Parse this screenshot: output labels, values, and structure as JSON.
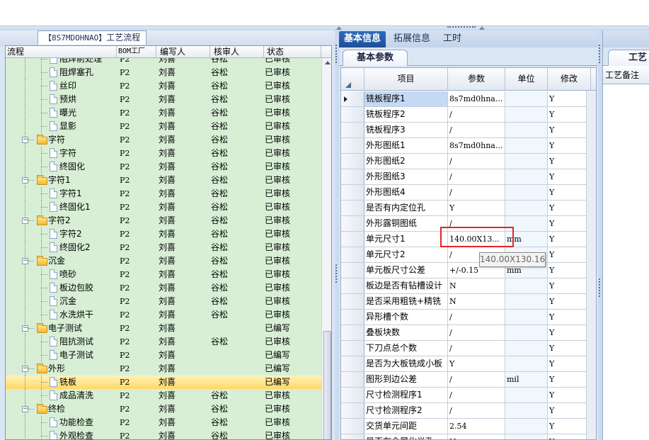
{
  "left_panel": {
    "tab_code": "【8S7MDOHNAO】",
    "tab_label": "工艺流程",
    "columns": [
      "流程",
      "BOM工厂",
      "编写人",
      "核审人",
      "状态"
    ],
    "rows": [
      {
        "level": 2,
        "type": "doc",
        "name": "阻焊前处理",
        "bom": "P2",
        "writer": "刘喜",
        "reviewer": "谷松",
        "status": "已审核"
      },
      {
        "level": 2,
        "type": "doc",
        "name": "阻焊塞孔",
        "bom": "P2",
        "writer": "刘喜",
        "reviewer": "谷松",
        "status": "已审核"
      },
      {
        "level": 2,
        "type": "doc",
        "name": "丝印",
        "bom": "P2",
        "writer": "刘喜",
        "reviewer": "谷松",
        "status": "已审核"
      },
      {
        "level": 2,
        "type": "doc",
        "name": "预烘",
        "bom": "P2",
        "writer": "刘喜",
        "reviewer": "谷松",
        "status": "已审核"
      },
      {
        "level": 2,
        "type": "doc",
        "name": "曝光",
        "bom": "P2",
        "writer": "刘喜",
        "reviewer": "谷松",
        "status": "已审核"
      },
      {
        "level": 2,
        "type": "doc",
        "name": "显影",
        "bom": "P2",
        "writer": "刘喜",
        "reviewer": "谷松",
        "status": "已审核"
      },
      {
        "level": 1,
        "type": "folder",
        "name": "字符",
        "bom": "P2",
        "writer": "刘喜",
        "reviewer": "谷松",
        "status": "已审核"
      },
      {
        "level": 2,
        "type": "doc",
        "name": "字符",
        "bom": "P2",
        "writer": "刘喜",
        "reviewer": "谷松",
        "status": "已审核"
      },
      {
        "level": 2,
        "type": "doc",
        "name": "终固化",
        "bom": "P2",
        "writer": "刘喜",
        "reviewer": "谷松",
        "status": "已审核"
      },
      {
        "level": 1,
        "type": "folder",
        "name": "字符1",
        "bom": "P2",
        "writer": "刘喜",
        "reviewer": "谷松",
        "status": "已审核"
      },
      {
        "level": 2,
        "type": "doc",
        "name": "字符1",
        "bom": "P2",
        "writer": "刘喜",
        "reviewer": "谷松",
        "status": "已审核"
      },
      {
        "level": 2,
        "type": "doc",
        "name": "终固化1",
        "bom": "P2",
        "writer": "刘喜",
        "reviewer": "谷松",
        "status": "已审核"
      },
      {
        "level": 1,
        "type": "folder",
        "name": "字符2",
        "bom": "P2",
        "writer": "刘喜",
        "reviewer": "谷松",
        "status": "已审核"
      },
      {
        "level": 2,
        "type": "doc",
        "name": "字符2",
        "bom": "P2",
        "writer": "刘喜",
        "reviewer": "谷松",
        "status": "已审核"
      },
      {
        "level": 2,
        "type": "doc",
        "name": "终固化2",
        "bom": "P2",
        "writer": "刘喜",
        "reviewer": "谷松",
        "status": "已审核"
      },
      {
        "level": 1,
        "type": "folder",
        "name": "沉金",
        "bom": "P2",
        "writer": "刘喜",
        "reviewer": "谷松",
        "status": "已审核"
      },
      {
        "level": 2,
        "type": "doc",
        "name": "喷砂",
        "bom": "P2",
        "writer": "刘喜",
        "reviewer": "谷松",
        "status": "已审核"
      },
      {
        "level": 2,
        "type": "doc",
        "name": "板边包胶",
        "bom": "P2",
        "writer": "刘喜",
        "reviewer": "谷松",
        "status": "已审核"
      },
      {
        "level": 2,
        "type": "doc",
        "name": "沉金",
        "bom": "P2",
        "writer": "刘喜",
        "reviewer": "谷松",
        "status": "已审核"
      },
      {
        "level": 2,
        "type": "doc",
        "name": "水洗烘干",
        "bom": "P2",
        "writer": "刘喜",
        "reviewer": "谷松",
        "status": "已审核"
      },
      {
        "level": 1,
        "type": "folder",
        "name": "电子测试",
        "bom": "P2",
        "writer": "刘喜",
        "reviewer": "",
        "status": "已编写"
      },
      {
        "level": 2,
        "type": "doc",
        "name": "阻抗测试",
        "bom": "P2",
        "writer": "刘喜",
        "reviewer": "谷松",
        "status": "已审核"
      },
      {
        "level": 2,
        "type": "doc",
        "name": "电子测试",
        "bom": "P2",
        "writer": "刘喜",
        "reviewer": "",
        "status": "已编写"
      },
      {
        "level": 1,
        "type": "folder",
        "name": "外形",
        "bom": "P2",
        "writer": "刘喜",
        "reviewer": "",
        "status": "已编写"
      },
      {
        "level": 2,
        "type": "doc",
        "name": "铣板",
        "bom": "P2",
        "writer": "刘喜",
        "reviewer": "",
        "status": "已编写",
        "selected": true
      },
      {
        "level": 2,
        "type": "doc",
        "name": "成品清洗",
        "bom": "P2",
        "writer": "刘喜",
        "reviewer": "谷松",
        "status": "已审核"
      },
      {
        "level": 1,
        "type": "folder",
        "name": "终检",
        "bom": "P2",
        "writer": "刘喜",
        "reviewer": "谷松",
        "status": "已审核"
      },
      {
        "level": 2,
        "type": "doc",
        "name": "功能检查",
        "bom": "P2",
        "writer": "刘喜",
        "reviewer": "谷松",
        "status": "已审核"
      },
      {
        "level": 2,
        "type": "doc",
        "name": "外观检查",
        "bom": "P2",
        "writer": "刘喜",
        "reviewer": "谷松",
        "status": "已审核"
      }
    ]
  },
  "right_panel": {
    "tabs": [
      "基本信息",
      "拓展信息",
      "工时"
    ],
    "active_tab": 0,
    "subtab": "基本参数",
    "columns": [
      "项目",
      "参数",
      "单位",
      "修改"
    ],
    "rows": [
      {
        "item": "铣板程序1",
        "param": "8s7md0hna...",
        "unit": "",
        "mod": "Y",
        "current": true
      },
      {
        "item": "铣板程序2",
        "param": "/",
        "unit": "",
        "mod": "Y"
      },
      {
        "item": "铣板程序3",
        "param": "/",
        "unit": "",
        "mod": "Y"
      },
      {
        "item": "外形图纸1",
        "param": "8s7md0hna...",
        "unit": "",
        "mod": "Y"
      },
      {
        "item": "外形图纸2",
        "param": "/",
        "unit": "",
        "mod": "Y"
      },
      {
        "item": "外形图纸3",
        "param": "/",
        "unit": "",
        "mod": "Y"
      },
      {
        "item": "外形图纸4",
        "param": "/",
        "unit": "",
        "mod": "Y"
      },
      {
        "item": "是否有内定位孔",
        "param": "Y",
        "unit": "",
        "mod": "Y"
      },
      {
        "item": "外形露铜图纸",
        "param": "/",
        "unit": "",
        "mod": "Y"
      },
      {
        "item": "单元尺寸1",
        "param": "140.00X13...",
        "unit": "mm",
        "mod": "Y"
      },
      {
        "item": "单元尺寸2",
        "param": "/",
        "unit": "",
        "mod": "Y"
      },
      {
        "item": "单元板尺寸公差",
        "param": "+/-0.15",
        "unit": "mm",
        "mod": "Y"
      },
      {
        "item": "板边是否有钻槽设计",
        "param": "N",
        "unit": "",
        "mod": "Y"
      },
      {
        "item": "是否采用粗铣+精铣",
        "param": "N",
        "unit": "",
        "mod": "Y"
      },
      {
        "item": "异形槽个数",
        "param": "/",
        "unit": "",
        "mod": "Y"
      },
      {
        "item": "叠板块数",
        "param": "/",
        "unit": "",
        "mod": "Y"
      },
      {
        "item": "下刀点总个数",
        "param": "/",
        "unit": "",
        "mod": "Y"
      },
      {
        "item": "是否为大板铣成小板",
        "param": "Y",
        "unit": "",
        "mod": "Y"
      },
      {
        "item": "图形到边公差",
        "param": "/",
        "unit": "mil",
        "mod": "Y"
      },
      {
        "item": "尺寸检测程序1",
        "param": "/",
        "unit": "",
        "mod": "Y"
      },
      {
        "item": "尺寸检测程序2",
        "param": "/",
        "unit": "",
        "mod": "Y"
      },
      {
        "item": "交货单元间距",
        "param": "2.54",
        "unit": "",
        "mod": "Y"
      },
      {
        "item": "是否有金属化半孔",
        "param": "N",
        "unit": "",
        "mod": "Y"
      }
    ],
    "tooltip": "140.00X130.16"
  },
  "far_right": {
    "subtab": "工艺",
    "column": "工艺备注"
  }
}
